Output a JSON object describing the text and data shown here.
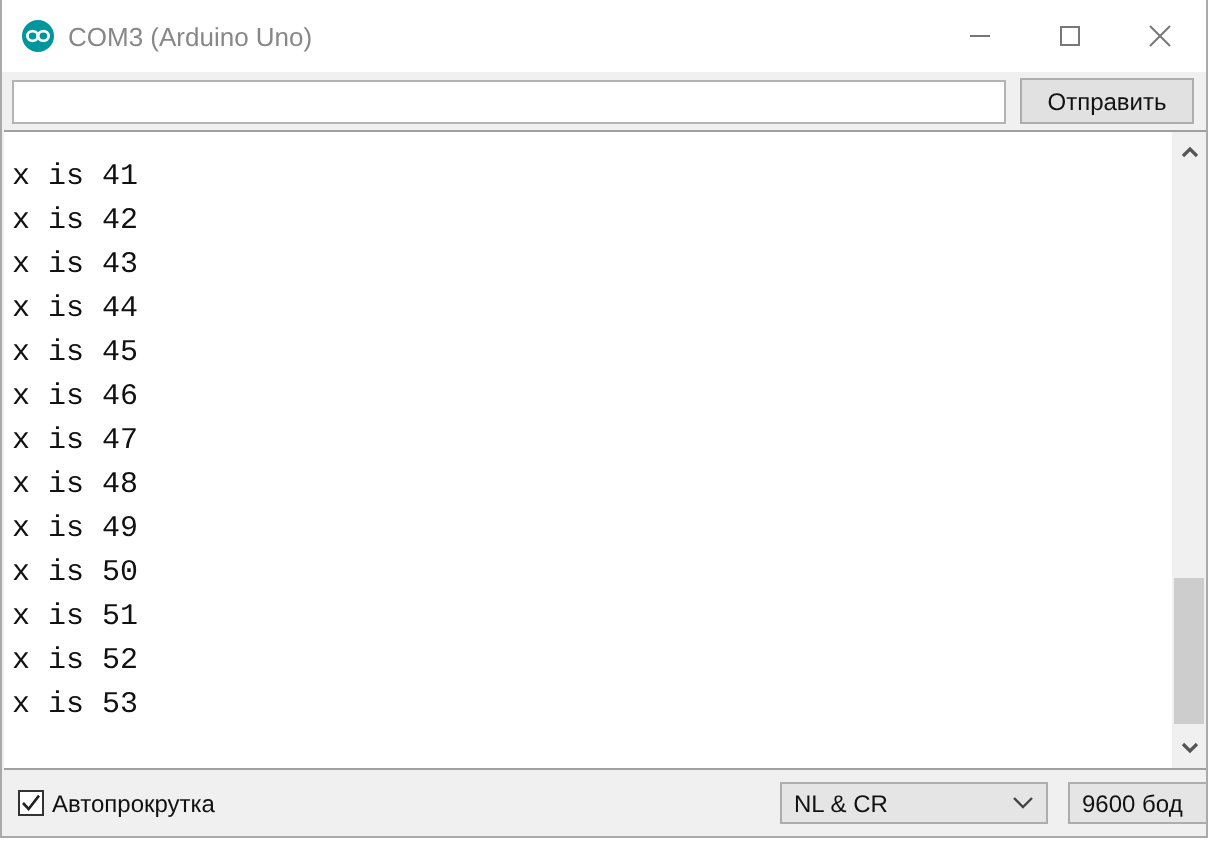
{
  "window": {
    "title": "COM3 (Arduino Uno)"
  },
  "send_button": {
    "label": "Отправить"
  },
  "output_lines": [
    "x is 41",
    "x is 42",
    "x is 43",
    "x is 44",
    "x is 45",
    "x is 46",
    "x is 47",
    "x is 48",
    "x is 49",
    "x is 50",
    "x is 51",
    "x is 52",
    "x is 53"
  ],
  "autoscroll": {
    "label": "Автопрокрутка",
    "checked": true
  },
  "line_ending": {
    "value": "NL & CR"
  },
  "baud_rate": {
    "value": "9600 бод"
  }
}
